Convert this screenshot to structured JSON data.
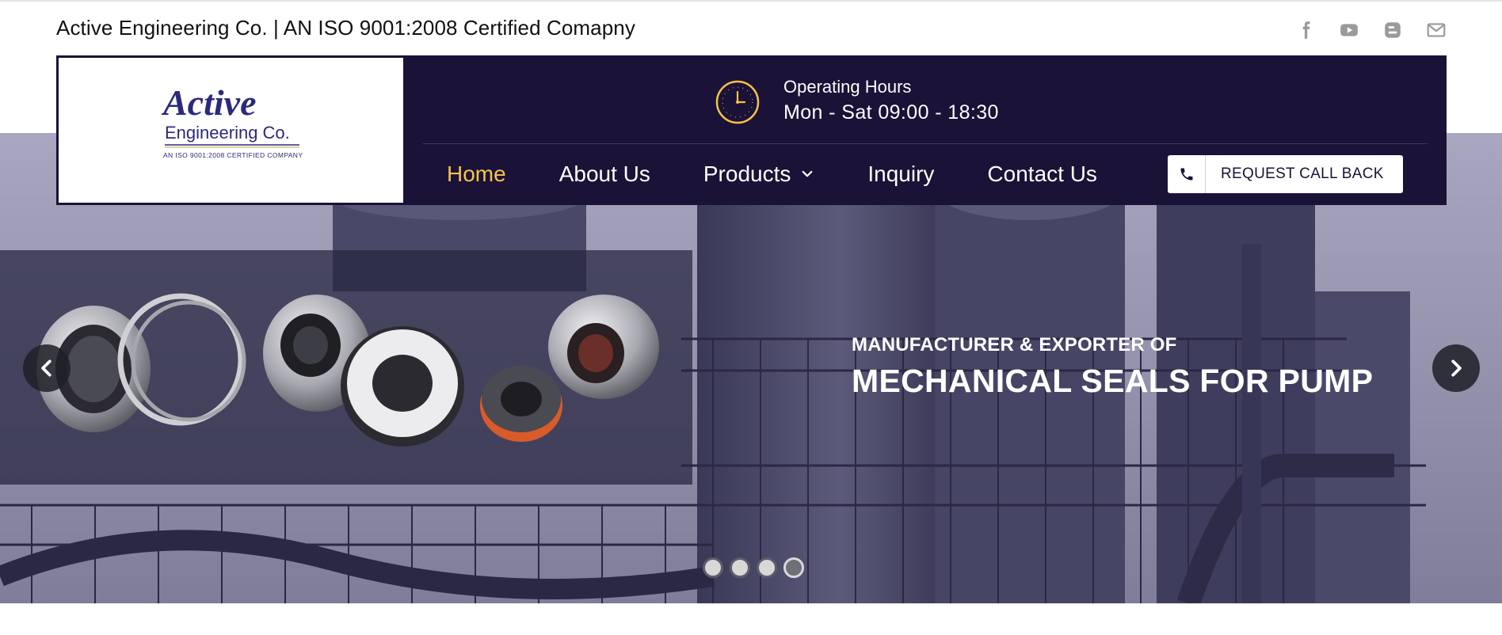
{
  "topbar": {
    "tagline": "Active Engineering Co.  |  AN ISO 9001:2008 Certified Comapny",
    "social": [
      "facebook-icon",
      "youtube-icon",
      "blogger-icon",
      "mail-icon"
    ]
  },
  "logo": {
    "brand": "Active",
    "company": "Engineering Co.",
    "certification": "AN ISO 9001:2008 CERTIFIED COMPANY"
  },
  "hours": {
    "label": "Operating Hours",
    "value": "Mon - Sat 09:00 - 18:30"
  },
  "nav": {
    "items": [
      {
        "label": "Home",
        "active": true
      },
      {
        "label": "About Us"
      },
      {
        "label": "Products",
        "dropdown": true
      },
      {
        "label": "Inquiry"
      },
      {
        "label": "Contact Us"
      }
    ]
  },
  "callback": {
    "label": "REQUEST CALL BACK"
  },
  "hero": {
    "kicker": "MANUFACTURER & EXPORTER OF",
    "title": "MECHANICAL SEALS FOR PUMP",
    "slide_count": 4,
    "active_slide": 4
  },
  "colors": {
    "navy": "#1b1238",
    "accent": "#f5c34a",
    "white": "#ffffff"
  }
}
